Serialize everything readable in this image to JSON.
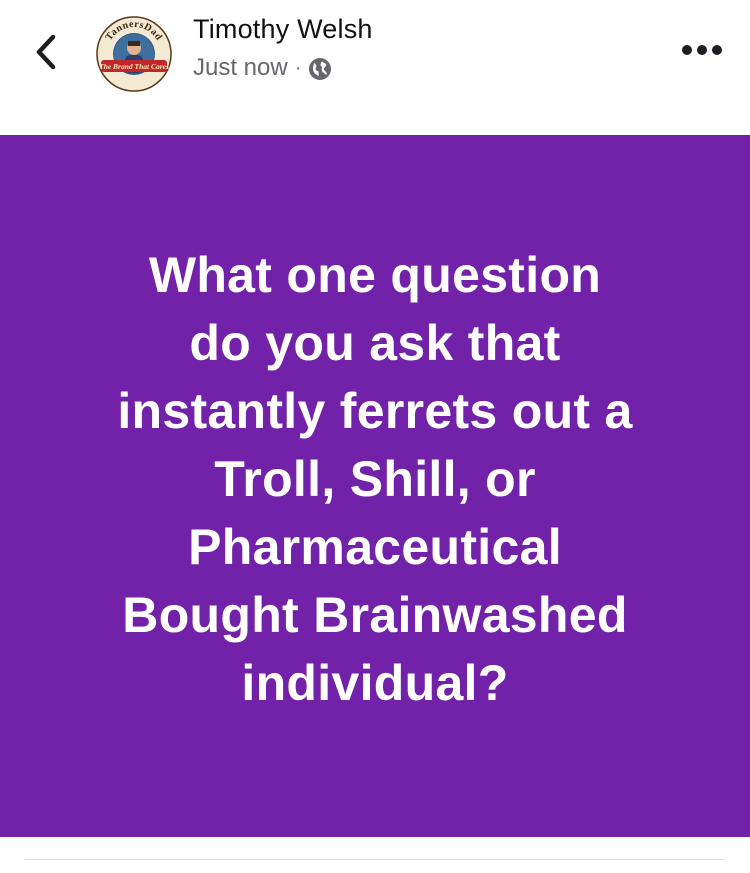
{
  "header": {
    "author_name": "Timothy Welsh",
    "timestamp": "Just now",
    "separator": "·",
    "avatar": {
      "text_top": "TannersDad",
      "text_bottom": "The Brand That Cares"
    }
  },
  "post": {
    "lines": [
      "What one question",
      "do you ask that",
      "instantly ferrets out a",
      "Troll, Shill, or",
      "Pharmaceutical",
      "Bought Brainwashed",
      "individual?"
    ],
    "background_color": "#7122a8"
  },
  "icons": {
    "back": "chevron-left-icon",
    "audience": "globe-icon",
    "more": "more-horizontal-icon"
  }
}
